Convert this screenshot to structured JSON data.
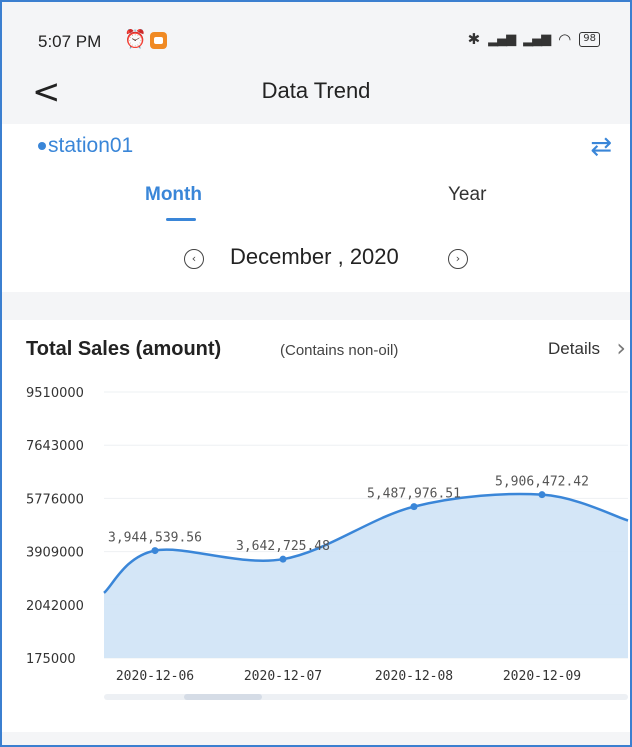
{
  "status_bar": {
    "time": "5:07 PM",
    "alarm_icon": "alarm-clock-icon",
    "app_icon": "notification-app-icon",
    "network": "HD",
    "battery": "98"
  },
  "header": {
    "back_label": "<",
    "title": "Data Trend"
  },
  "station": {
    "name": "station01",
    "swap_icon": "⇄"
  },
  "tabs": [
    {
      "label": "Month",
      "active": true
    },
    {
      "label": "Year",
      "active": false
    }
  ],
  "date": {
    "label": "December , 2020",
    "prev_icon": "‹",
    "next_icon": "›"
  },
  "card": {
    "title": "Total Sales (amount)",
    "subtitle": "(Contains non-oil)",
    "details_label": "Details",
    "details_chevron": "›"
  },
  "colors": {
    "accent": "#3a86d8",
    "line": "#3a86d8",
    "area": "#cfe3f6"
  },
  "chart_data": {
    "type": "area",
    "title": "Total Sales (amount)",
    "y_ticks": [
      "9510000",
      "7643000",
      "5776000",
      "3909000",
      "2042000",
      "175000"
    ],
    "ylim": [
      175000,
      9510000
    ],
    "categories": [
      "2020-12-06",
      "2020-12-07",
      "2020-12-08",
      "2020-12-09"
    ],
    "values": [
      3944539.56,
      3642725.48,
      5487976.51,
      5906472.42
    ],
    "value_labels": [
      "3,944,539.56",
      "3,642,725.48",
      "5,487,976.51",
      "5,906,472.42"
    ],
    "grid": true,
    "legend": "none",
    "scrollable": true
  }
}
